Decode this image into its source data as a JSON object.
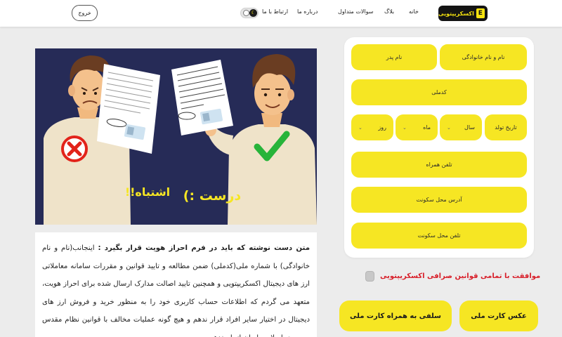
{
  "header": {
    "logo_text": "اکسکریپتویی",
    "logo_mark": "E",
    "nav": [
      "خانه",
      "بلاگ",
      "سوالات متداول",
      "درباره ما",
      "ارتباط با ما"
    ],
    "logout_label": "خروج"
  },
  "illustration": {
    "wrong_label": "اشتباه!!",
    "right_label": "درست :)"
  },
  "text": {
    "bold": "متن دست نوشته که باید در فرم احراز هویت قرار بگیرد :",
    "body": " اینجانب(نام و نام خانوادگی) با شماره ملی(کدملی) ضمن مطالعه و تایید قوانین و مقررات سامانه معاملاتی ارز های دیجیتال اکسکریپتویی و همچنین تایید اصالت مدارک ارسال شده برای احراز هویت، متعهد می گردم که اطلاعات حساب کاربری خود را به منظور خرید و فروش ارز های دیجیتال در اختیار سایر افراد قرار ندهم و هیچ گونه عملیات مخالف با قوانین نظام مقدس جمهوری اسلامی ایران انجام ندهم."
  },
  "form": {
    "fullname": "نام و نام خانوادگی",
    "father_name": "نام پدر",
    "national_code": "کدملی",
    "birth_date": "تاریخ تولد",
    "year": "سال",
    "month": "ماه",
    "day": "روز",
    "phone": "تلفن همراه",
    "address": "آدرس محل سکونت",
    "home_phone": "تلفن محل سکونت"
  },
  "agreement": {
    "label": "موافقت با تمامی قوانین صرافی اکسکریپتویی",
    "checked": false
  },
  "buttons": {
    "id_card_photo": "عکس کارت ملی",
    "selfie": "سلفی به همراه کارت ملی"
  },
  "colors": {
    "accent": "#f6e623",
    "dark": "#141414",
    "illustration_bg": "#262b57",
    "danger": "#d81f2a",
    "success": "#27b43a"
  }
}
